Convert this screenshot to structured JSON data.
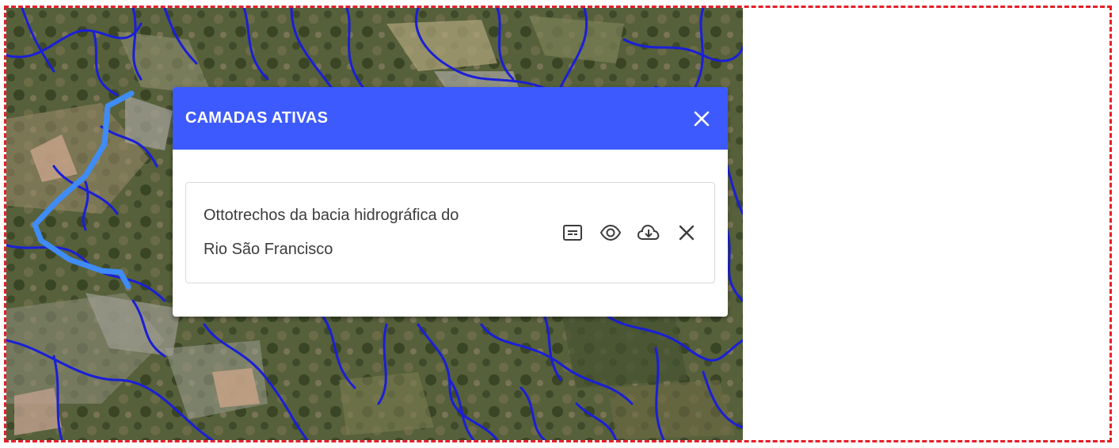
{
  "map": {
    "description_icon": "satellite-basemap",
    "river_color": "#1a1fd6",
    "highlight_color": "#3f8cf7"
  },
  "panel": {
    "title": "CAMADAS ATIVAS",
    "header_color": "#3d5afe",
    "close_icon": "close-icon",
    "layers": [
      {
        "name": "Ottotrechos da bacia hidrográfica do Rio São Francisco",
        "actions": [
          "legend-icon",
          "visibility-eye-icon",
          "cloud-download-icon",
          "remove-icon"
        ]
      }
    ]
  }
}
